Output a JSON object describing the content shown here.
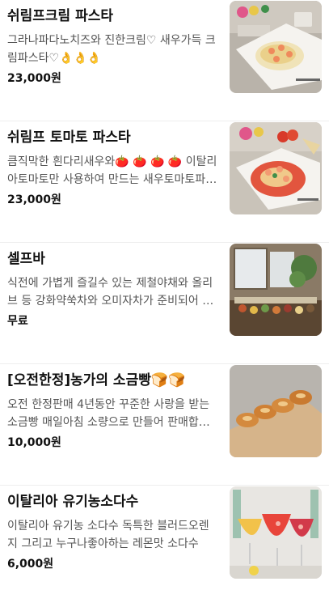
{
  "menu": {
    "items": [
      {
        "name": "쉬림프크림 파스타",
        "description": "그라나파다노치즈와 진한크림♡ 새우가득 크림파스타♡👌👌👌",
        "price": "23,000원",
        "image_icon": "shrimp-cream-pasta-photo"
      },
      {
        "name": "쉬림프 토마토 파스타",
        "description": "큼직막한 흰다리새우와🍅 🍅 🍅 🍅 이탈리아토마토만 사용하여 만드는 새우토마토파스타",
        "price": "23,000원",
        "image_icon": "shrimp-tomato-pasta-photo"
      },
      {
        "name": "셀프바",
        "description": "식전에 가볍게 즐길수 있는 제철야채와 올리브 등 강화약쑥차와 오미자차가 준비되어 있습니다",
        "price": "무료",
        "image_icon": "self-bar-photo"
      },
      {
        "name": "[오전한정]농가의 소금빵🍞🍞",
        "description": "오전 한정판매 4년동안 꾸준한 사랑을 받는 소금빵 매일아침 소량으로 만들어 판매합니다",
        "price": "10,000원",
        "image_icon": "salt-bread-photo"
      },
      {
        "name": "이탈리아 유기농소다수",
        "description": "이탈리아 유기농 소다수 독특한 블러드오렌지 그리고 누구나좋아하는 레몬맛 소다수",
        "price": "6,000원",
        "image_icon": "organic-soda-photo"
      }
    ]
  }
}
